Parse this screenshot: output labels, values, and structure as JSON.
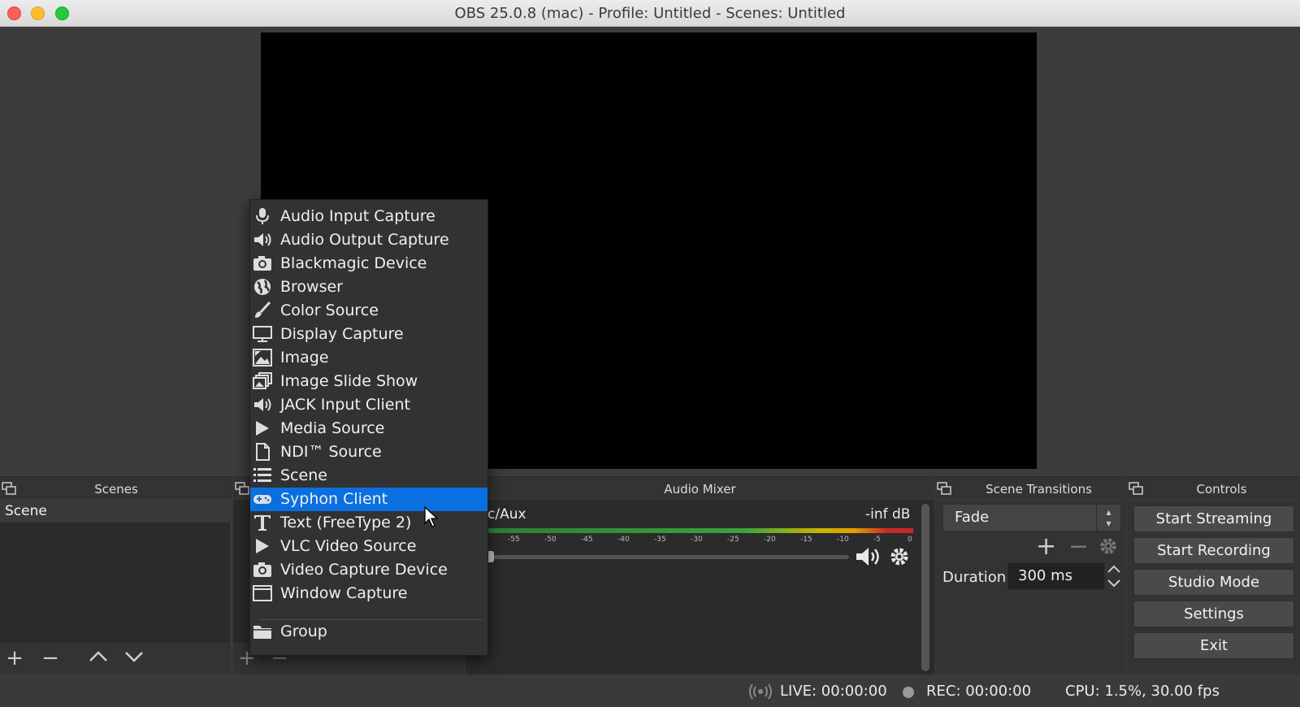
{
  "window": {
    "title": "OBS 25.0.8 (mac) - Profile: Untitled - Scenes: Untitled"
  },
  "docks": {
    "scenes": "Scenes",
    "audio_mixer": "Audio Mixer",
    "scene_transitions": "Scene Transitions",
    "controls": "Controls"
  },
  "scenes": {
    "items": [
      "Scene"
    ]
  },
  "context_menu": {
    "items": [
      {
        "label": "Audio Input Capture",
        "icon": "microphone-icon"
      },
      {
        "label": "Audio Output Capture",
        "icon": "speaker-icon"
      },
      {
        "label": "Blackmagic Device",
        "icon": "camera-icon"
      },
      {
        "label": "Browser",
        "icon": "globe-icon"
      },
      {
        "label": "Color Source",
        "icon": "brush-icon"
      },
      {
        "label": "Display Capture",
        "icon": "monitor-icon"
      },
      {
        "label": "Image",
        "icon": "image-icon"
      },
      {
        "label": "Image Slide Show",
        "icon": "slideshow-icon"
      },
      {
        "label": "JACK Input Client",
        "icon": "speaker-icon"
      },
      {
        "label": "Media Source",
        "icon": "play-icon"
      },
      {
        "label": "NDI™ Source",
        "icon": "document-icon"
      },
      {
        "label": "Scene",
        "icon": "list-icon"
      },
      {
        "label": "Syphon Client",
        "icon": "gamepad-icon",
        "selected": true
      },
      {
        "label": "Text (FreeType 2)",
        "icon": "text-icon"
      },
      {
        "label": "VLC Video Source",
        "icon": "play-icon"
      },
      {
        "label": "Video Capture Device",
        "icon": "camera-icon"
      },
      {
        "label": "Window Capture",
        "icon": "window-icon"
      },
      {
        "label": "Group",
        "icon": "folder-icon"
      }
    ]
  },
  "audio_mixer": {
    "track_name": "c/Aux",
    "level": "-inf dB",
    "ticks": [
      "-55",
      "-50",
      "-45",
      "-40",
      "-35",
      "-30",
      "-25",
      "-20",
      "-15",
      "-10",
      "-5",
      "0"
    ]
  },
  "transitions": {
    "selected": "Fade",
    "duration_label": "Duration",
    "duration_value": "300 ms"
  },
  "controls": {
    "start_streaming": "Start Streaming",
    "start_recording": "Start Recording",
    "studio_mode": "Studio Mode",
    "settings": "Settings",
    "exit": "Exit"
  },
  "status": {
    "live": "LIVE: 00:00:00",
    "rec": "REC: 00:00:00",
    "cpu": "CPU: 1.5%, 30.00 fps"
  },
  "colors": {
    "selection": "#0a6fe0",
    "panel": "#2b2b2b",
    "background": "#3a3a3a"
  }
}
